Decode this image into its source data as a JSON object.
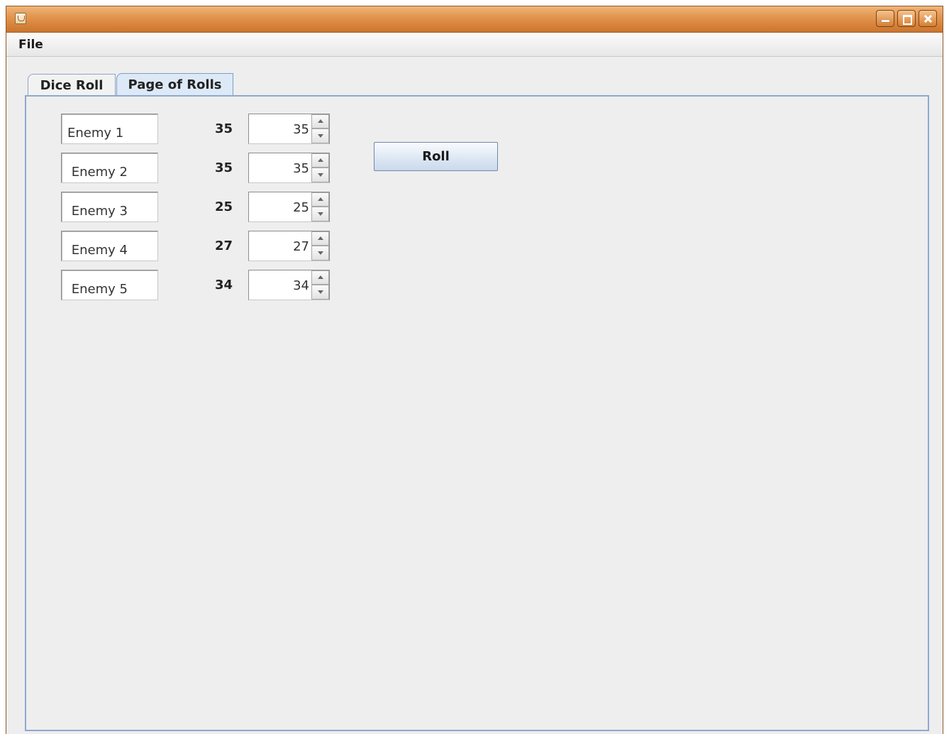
{
  "window": {
    "title": "",
    "titlebar_color": "#d9843c",
    "controls": [
      "minimize-icon",
      "maximize-icon",
      "close-icon"
    ]
  },
  "menu": {
    "items": [
      {
        "label": "File"
      }
    ]
  },
  "tabs": [
    {
      "label": "Dice Roll",
      "selected": false
    },
    {
      "label": "Page of Rolls",
      "selected": true
    }
  ],
  "rows": [
    {
      "name": "Enemy 1",
      "roll": "35",
      "spinner_value": "35"
    },
    {
      "name": " Enemy 2",
      "roll": "35",
      "spinner_value": "35"
    },
    {
      "name": " Enemy 3",
      "roll": "25",
      "spinner_value": "25"
    },
    {
      "name": " Enemy 4",
      "roll": "27",
      "spinner_value": "27"
    },
    {
      "name": " Enemy 5",
      "roll": "34",
      "spinner_value": "34"
    }
  ],
  "actions": {
    "roll_label": "Roll"
  },
  "colors": {
    "panel_border": "#8ea9cf",
    "selected_tab": "#dde9f7",
    "background": "#eeeeee"
  }
}
